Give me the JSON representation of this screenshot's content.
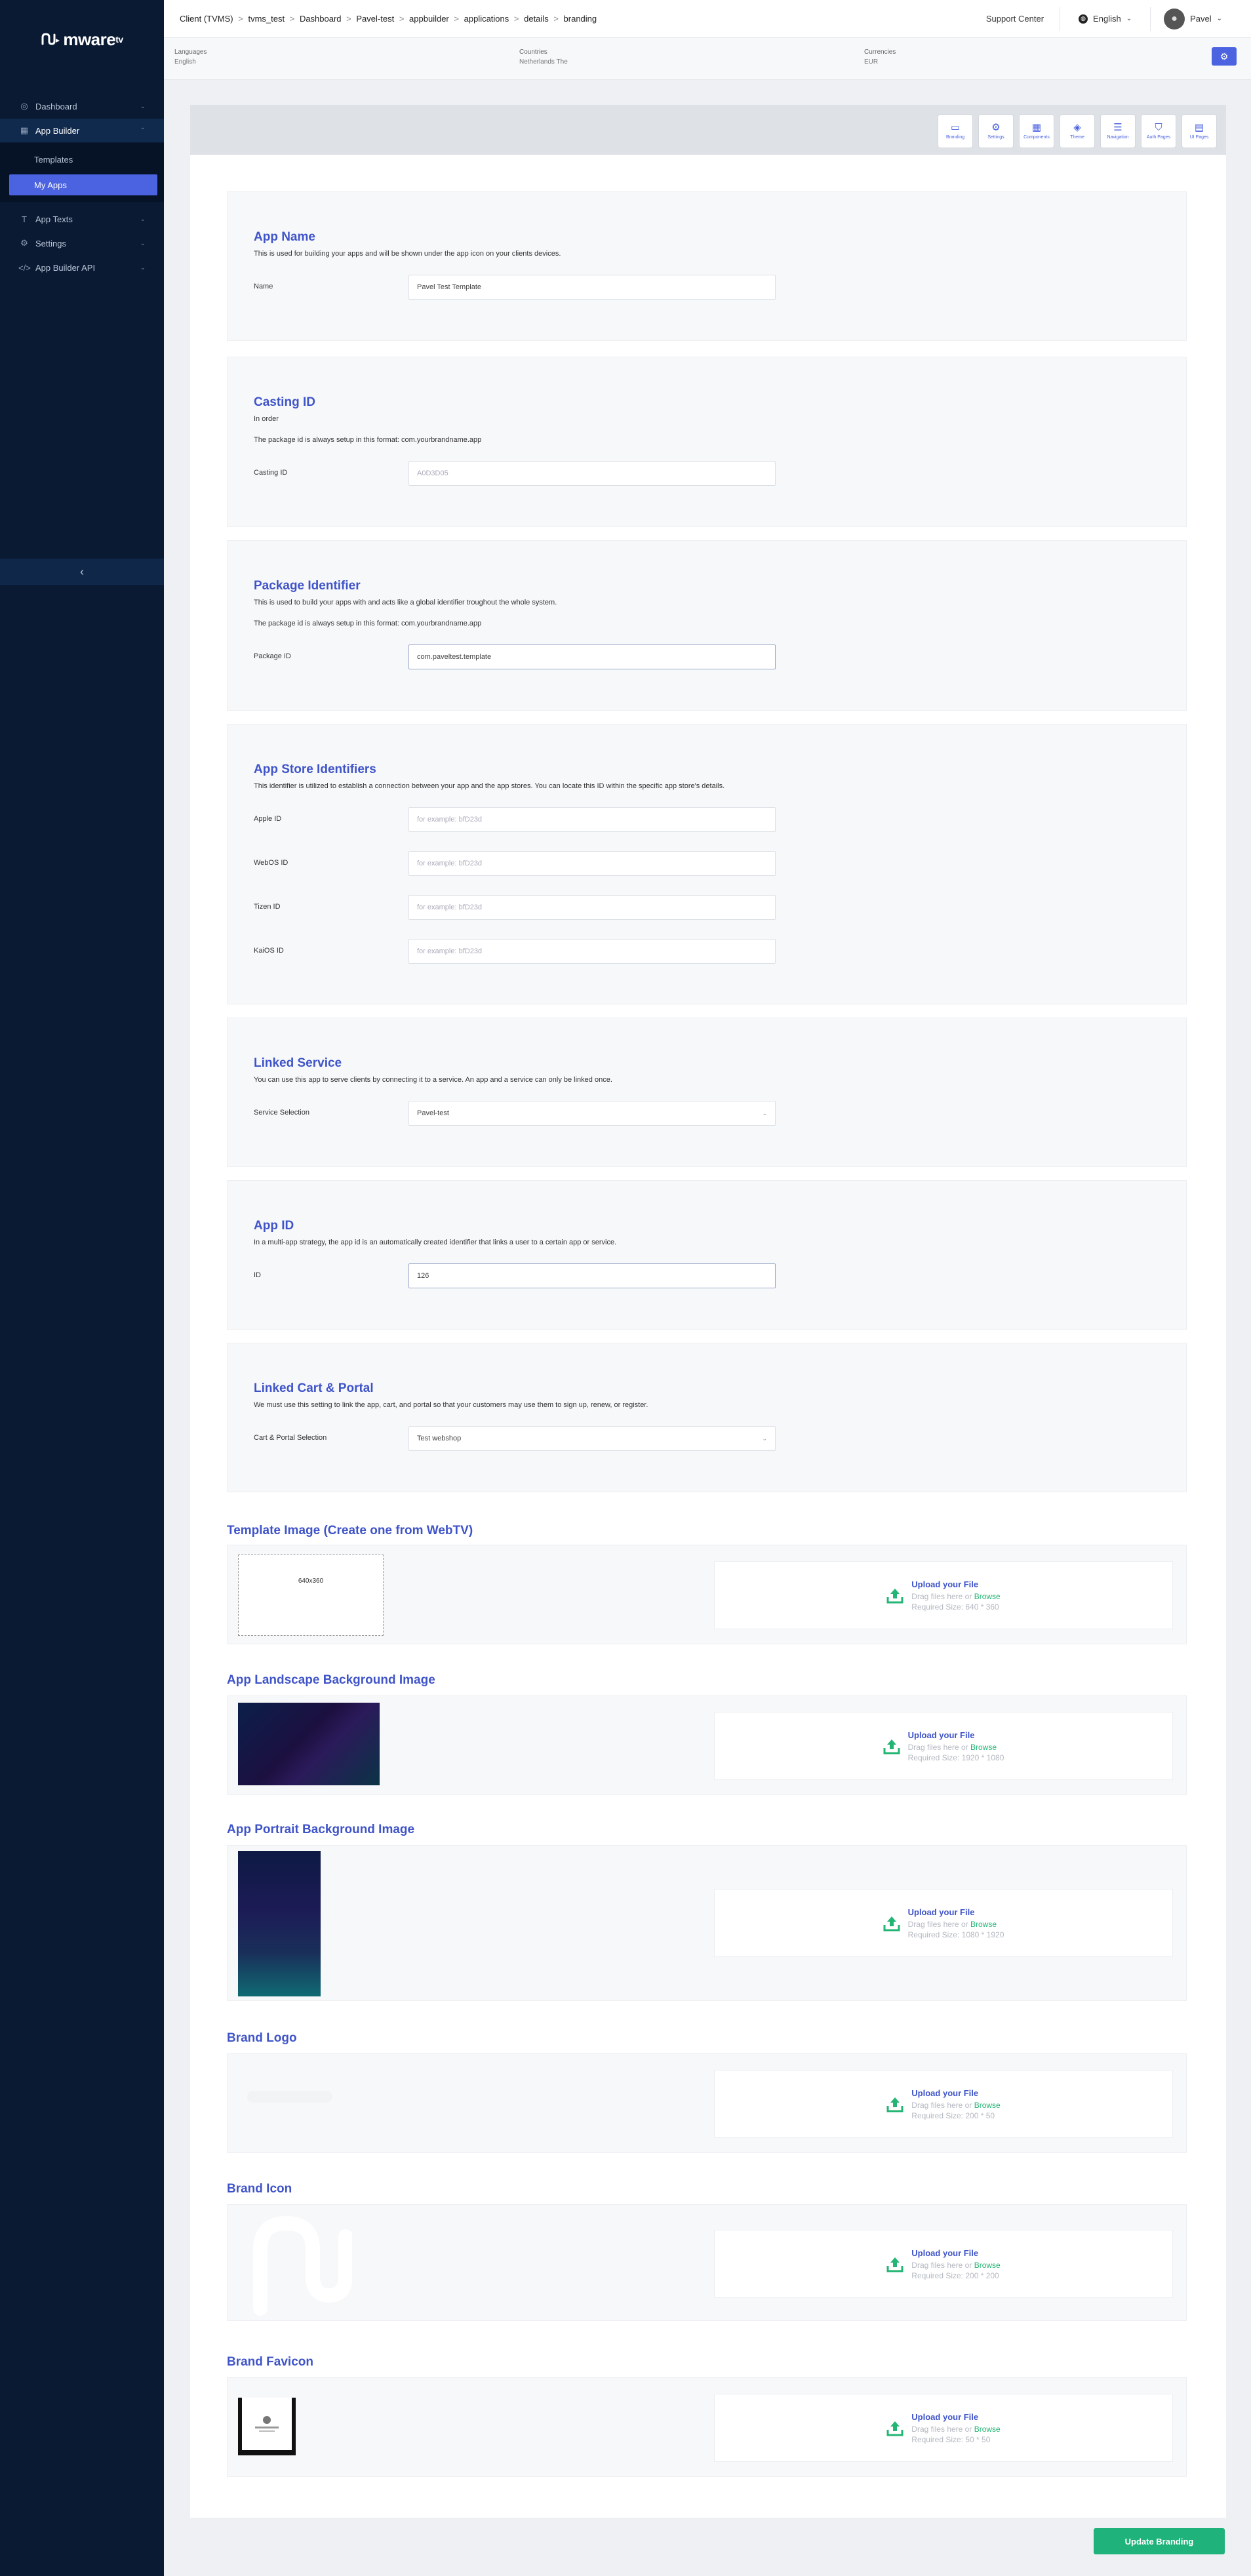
{
  "sidebar": {
    "brand": "mware",
    "brand_suffix": "tv",
    "items": [
      {
        "label": "Dashboard"
      },
      {
        "label": "App Builder"
      },
      {
        "label": "Templates"
      },
      {
        "label": "My Apps"
      },
      {
        "label": "App Texts"
      },
      {
        "label": "Settings"
      },
      {
        "label": "App Builder API"
      }
    ],
    "collapse_glyph": "‹"
  },
  "header": {
    "crumbs": [
      "Client (TVMS)",
      ">",
      "tvms_test",
      ">",
      "Dashboard",
      ">",
      "Pavel-test",
      ">",
      "appbuilder",
      ">",
      "applications",
      ">",
      "details",
      ">",
      "branding"
    ],
    "support": "Support Center",
    "language": "English",
    "user": "Pavel"
  },
  "info": {
    "languages_label": "Languages",
    "languages_value": "English",
    "countries_label": "Countries",
    "countries_value": "Netherlands The",
    "currencies_label": "Currencies",
    "currencies_value": "EUR"
  },
  "toolbar": [
    {
      "label": "Branding"
    },
    {
      "label": "Settings"
    },
    {
      "label": "Components"
    },
    {
      "label": "Theme"
    },
    {
      "label": "Navigation"
    },
    {
      "label": "Auth Pages"
    },
    {
      "label": "UI Pages"
    }
  ],
  "sections": {
    "app_name": {
      "title": "App Name",
      "desc": "This is used for building your apps and will be shown under the app icon on your clients devices.",
      "label": "Name",
      "value": "Pavel Test Template"
    },
    "casting": {
      "title": "Casting ID",
      "desc1": "In order",
      "desc2": "The package id is always setup in this format: com.yourbrandname.app",
      "label": "Casting ID",
      "placeholder": "A0D3D05"
    },
    "package": {
      "title": "Package Identifier",
      "desc1": "This is used to build your apps with and acts like a global identifier troughout the whole system.",
      "desc2": "The package id is always setup in this format: com.yourbrandname.app",
      "label": "Package ID",
      "value": "com.paveltest.template"
    },
    "store": {
      "title": "App Store Identifiers",
      "desc": "This identifier is utilized to establish a connection between your app and the app stores. You can locate this ID within the specific app store's details.",
      "apple_label": "Apple ID",
      "webos_label": "WebOS ID",
      "tizen_label": "Tizen ID",
      "kaios_label": "KaiOS ID",
      "placeholder": "for example: bfD23d"
    },
    "linked_service": {
      "title": "Linked Service",
      "desc": "You can use this app to serve clients by connecting it to a service. An app and a service can only be linked once.",
      "label": "Service Selection",
      "value": "Pavel-test"
    },
    "app_id": {
      "title": "App ID",
      "desc": "In a multi-app strategy, the app id is an automatically created identifier that links a user to a certain app or service.",
      "label": "ID",
      "value": "126"
    },
    "linked_cart": {
      "title": "Linked Cart & Portal",
      "desc": "We must use this setting to link the app, cart, and portal so that your customers may use them to sign up, renew, or register.",
      "label": "Cart & Portal Selection",
      "value": "Test webshop"
    }
  },
  "images": {
    "template": {
      "title": "Template Image (Create one from WebTV)",
      "placeholder": "640x360",
      "size": "Required Size: 640 * 360"
    },
    "landscape": {
      "title": "App Landscape Background Image",
      "size": "Required Size: 1920 * 1080"
    },
    "portrait": {
      "title": "App Portrait Background Image",
      "size": "Required Size: 1080 * 1920"
    },
    "logo": {
      "title": "Brand Logo",
      "size": "Required Size: 200 * 50"
    },
    "icon": {
      "title": "Brand Icon",
      "size": "Required Size: 200 * 200"
    },
    "favicon": {
      "title": "Brand Favicon",
      "size": "Required Size: 50 * 50"
    }
  },
  "uploader": {
    "title": "Upload your File",
    "drag": "Drag files here or",
    "browse": "Browse"
  },
  "footer": {
    "update": "Update Branding"
  },
  "colors": {
    "accent": "#4b63e0",
    "title": "#3f54c8",
    "success": "#1fb27a",
    "sidebar": "#0a1a33"
  }
}
